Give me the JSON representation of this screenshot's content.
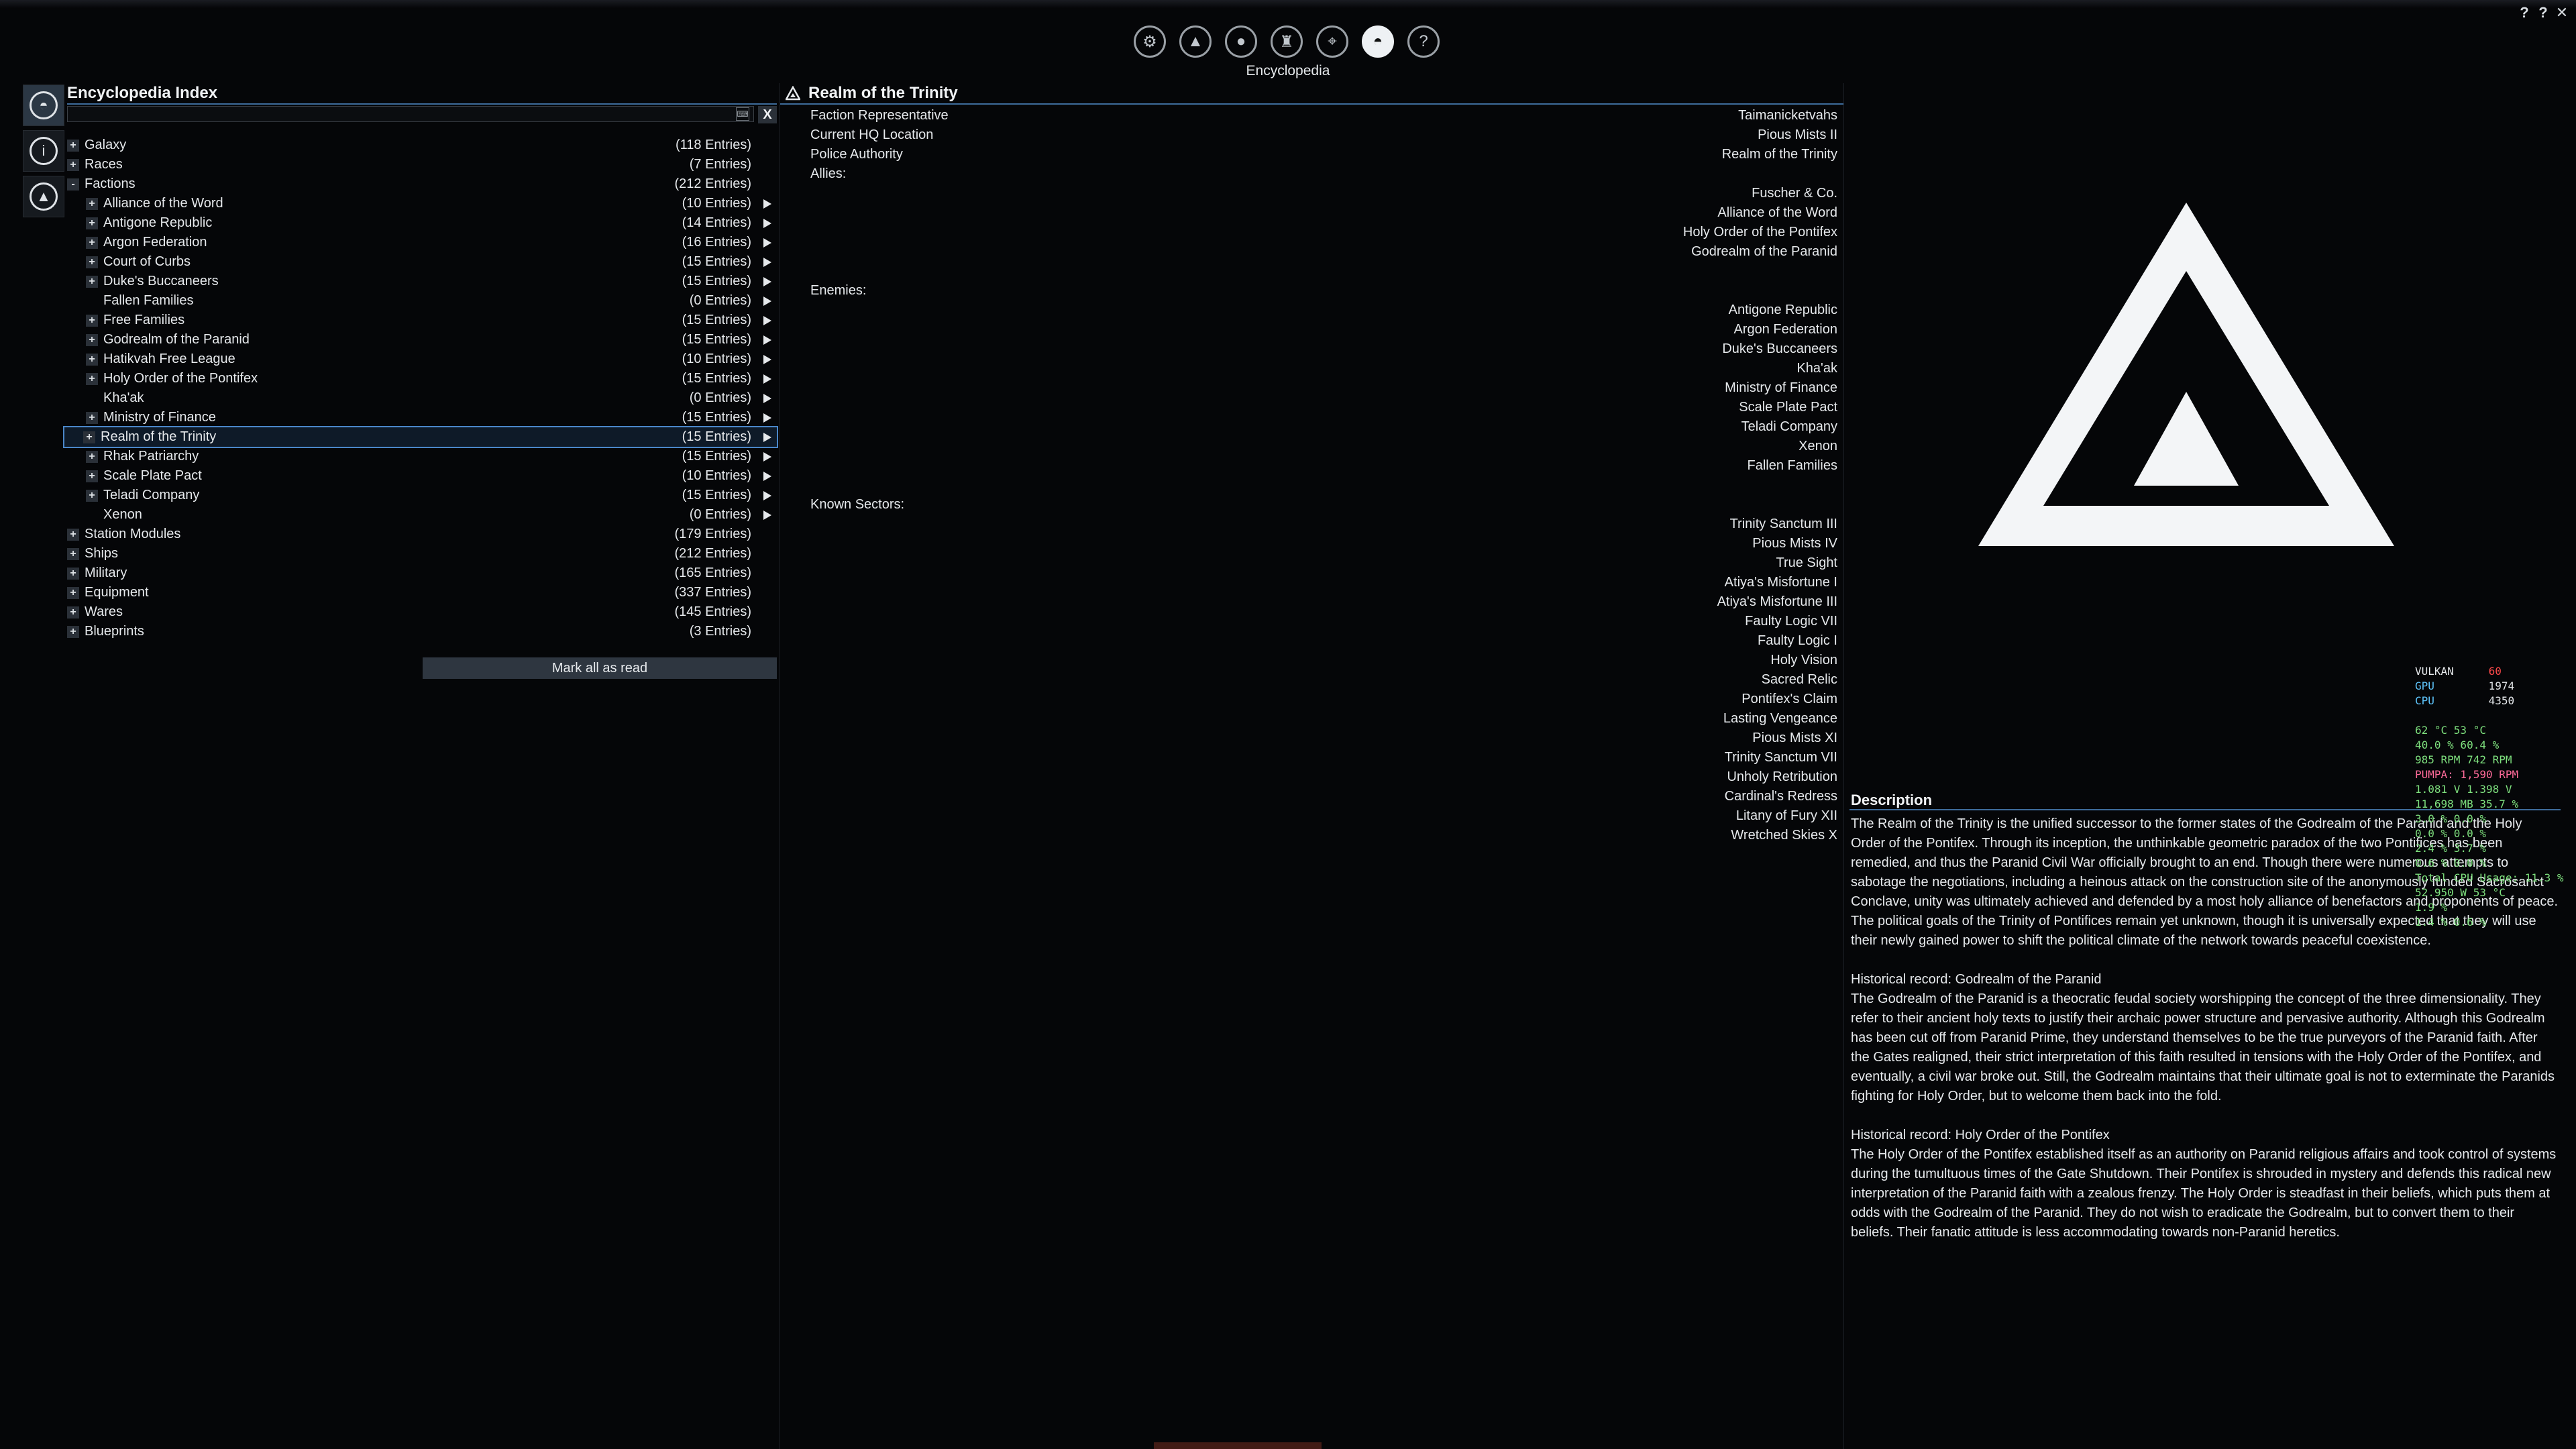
{
  "window": {
    "controls": [
      "?",
      "?",
      "✕"
    ]
  },
  "topbar": {
    "label": "Encyclopedia",
    "icons": [
      {
        "name": "settings-icon",
        "glyph": "⚙"
      },
      {
        "name": "faction-icon",
        "glyph": "▲"
      },
      {
        "name": "player-icon",
        "glyph": "●"
      },
      {
        "name": "ship-icon",
        "glyph": "♜"
      },
      {
        "name": "map-icon",
        "glyph": "⌖"
      },
      {
        "name": "encyclopedia-icon",
        "glyph": "◓",
        "active": true
      },
      {
        "name": "help-icon",
        "glyph": "?"
      }
    ]
  },
  "rail": [
    {
      "name": "encyclopedia-tab-icon",
      "glyph": "◓",
      "active": true
    },
    {
      "name": "info-tab-icon",
      "glyph": "i"
    },
    {
      "name": "faction-tab-icon",
      "glyph": "▲"
    }
  ],
  "index": {
    "title": "Encyclopedia Index",
    "search_value": "",
    "clear_label": "X",
    "mark_all_label": "Mark all as read",
    "rows": [
      {
        "level": 0,
        "expander": "+",
        "label": "Galaxy",
        "count": "(118 Entries)",
        "arrow": false
      },
      {
        "level": 0,
        "expander": "+",
        "label": "Races",
        "count": "(7 Entries)",
        "arrow": false
      },
      {
        "level": 0,
        "expander": "-",
        "label": "Factions",
        "count": "(212 Entries)",
        "arrow": false
      },
      {
        "level": 1,
        "expander": "+",
        "label": "Alliance of the Word",
        "count": "(10 Entries)",
        "arrow": true
      },
      {
        "level": 1,
        "expander": "+",
        "label": "Antigone Republic",
        "count": "(14 Entries)",
        "arrow": true
      },
      {
        "level": 1,
        "expander": "+",
        "label": "Argon Federation",
        "count": "(16 Entries)",
        "arrow": true
      },
      {
        "level": 1,
        "expander": "+",
        "label": "Court of Curbs",
        "count": "(15 Entries)",
        "arrow": true
      },
      {
        "level": 1,
        "expander": "+",
        "label": "Duke's Buccaneers",
        "count": "(15 Entries)",
        "arrow": true
      },
      {
        "level": 1,
        "expander": "",
        "label": "Fallen Families",
        "count": "(0 Entries)",
        "arrow": true
      },
      {
        "level": 1,
        "expander": "+",
        "label": "Free Families",
        "count": "(15 Entries)",
        "arrow": true
      },
      {
        "level": 1,
        "expander": "+",
        "label": "Godrealm of the Paranid",
        "count": "(15 Entries)",
        "arrow": true
      },
      {
        "level": 1,
        "expander": "+",
        "label": "Hatikvah Free League",
        "count": "(10 Entries)",
        "arrow": true
      },
      {
        "level": 1,
        "expander": "+",
        "label": "Holy Order of the Pontifex",
        "count": "(15 Entries)",
        "arrow": true
      },
      {
        "level": 1,
        "expander": "",
        "label": "Kha'ak",
        "count": "(0 Entries)",
        "arrow": true
      },
      {
        "level": 1,
        "expander": "+",
        "label": "Ministry of Finance",
        "count": "(15 Entries)",
        "arrow": true
      },
      {
        "level": 1,
        "expander": "+",
        "label": "Realm of the Trinity",
        "count": "(15 Entries)",
        "arrow": true,
        "selected": true
      },
      {
        "level": 1,
        "expander": "+",
        "label": "Rhak Patriarchy",
        "count": "(15 Entries)",
        "arrow": true
      },
      {
        "level": 1,
        "expander": "+",
        "label": "Scale Plate Pact",
        "count": "(10 Entries)",
        "arrow": true
      },
      {
        "level": 1,
        "expander": "+",
        "label": "Teladi Company",
        "count": "(15 Entries)",
        "arrow": true
      },
      {
        "level": 1,
        "expander": "",
        "label": "Xenon",
        "count": "(0 Entries)",
        "arrow": true
      },
      {
        "level": 0,
        "expander": "+",
        "label": "Station Modules",
        "count": "(179 Entries)",
        "arrow": false
      },
      {
        "level": 0,
        "expander": "+",
        "label": "Ships",
        "count": "(212 Entries)",
        "arrow": false
      },
      {
        "level": 0,
        "expander": "+",
        "label": "Military",
        "count": "(165 Entries)",
        "arrow": false
      },
      {
        "level": 0,
        "expander": "+",
        "label": "Equipment",
        "count": "(337 Entries)",
        "arrow": false
      },
      {
        "level": 0,
        "expander": "+",
        "label": "Wares",
        "count": "(145 Entries)",
        "arrow": false
      },
      {
        "level": 0,
        "expander": "+",
        "label": "Blueprints",
        "count": "(3 Entries)",
        "arrow": false
      }
    ]
  },
  "detail": {
    "title": "Realm of the Trinity",
    "labels": {
      "representative": "Faction Representative",
      "hq": "Current HQ Location",
      "police": "Police Authority",
      "allies": "Allies:",
      "enemies": "Enemies:",
      "sectors": "Known Sectors:"
    },
    "representative": "Taimanicketvahs",
    "hq": "Pious Mists II",
    "police": "Realm of the Trinity",
    "allies": [
      "Fuscher & Co.",
      "Alliance of the Word",
      "Holy Order of the Pontifex",
      "Godrealm of the Paranid"
    ],
    "enemies": [
      "Antigone Republic",
      "Argon Federation",
      "Duke's Buccaneers",
      "Kha'ak",
      "Ministry of Finance",
      "Scale Plate Pact",
      "Teladi Company",
      "Xenon",
      "Fallen Families"
    ],
    "sectors": [
      "Trinity Sanctum III",
      "Pious Mists IV",
      "True Sight",
      "Atiya's Misfortune I",
      "Atiya's Misfortune III",
      "Faulty Logic VII",
      "Faulty Logic I",
      "Holy Vision",
      "Sacred Relic",
      "Pontifex's Claim",
      "Lasting Vengeance",
      "Pious Mists XI",
      "Trinity Sanctum VII",
      "Unholy Retribution",
      "Cardinal's Redress",
      "Litany of Fury XII",
      "Wretched Skies X"
    ]
  },
  "description": {
    "title": "Description",
    "intro": "The Realm of the Trinity is the unified successor to the former states of the Godrealm of the Paranid and the Holy Order of the Pontifex. Through its inception, the unthinkable geometric paradox of the two Pontifices has been remedied, and thus the Paranid Civil War officially brought to an end. Though there were numerous attempts to sabotage the negotiations, including a heinous attack on the construction site of the anonymously funded Sacrosanct Conclave, unity was ultimately achieved and defended by a most holy alliance of benefactors and proponents of peace. The political goals of the Trinity of Pontifices remain yet unknown, though it is universally expected that they will use their newly gained power to shift the political climate of the network towards peaceful coexistence.",
    "hist1_title": "Historical record: Godrealm of the Paranid",
    "hist1": "The Godrealm of the Paranid is a theocratic feudal society worshipping the concept of the three dimensionality. They refer to their ancient holy texts to justify their archaic power structure and pervasive authority. Although this Godrealm has been cut off from Paranid Prime, they understand themselves to be the true purveyors of the Paranid faith. After the Gates realigned, their strict interpretation of this faith resulted in tensions with the Holy Order of the Pontifex, and eventually, a civil war broke out. Still, the Godrealm maintains that their ultimate goal is not to exterminate the Paranids fighting for Holy Order, but to welcome them back into the fold.",
    "hist2_title": "Historical record: Holy Order of the Pontifex",
    "hist2": "The Holy Order of the Pontifex established itself as an authority on Paranid religious affairs and took control of systems during the tumultuous times of the Gate Shutdown. Their Pontifex is shrouded in mystery and defends this radical new interpretation of the Paranid faith with a zealous frenzy. The Holy Order is steadfast in their beliefs, which puts them at odds with the Godrealm of the Paranid. They do not wish to eradicate the Godrealm, but to convert them to their beliefs. Their fanatic attitude is less accommodating towards non-Paranid heretics."
  },
  "hud": {
    "api": "VULKAN",
    "fps": "60",
    "gpu_label": "GPU",
    "gpu_mhz": "1974",
    "cpu_label": "CPU",
    "cpu_mhz": "4350",
    "lines": [
      {
        "cls": "g",
        "text": "62 °C 53 °C"
      },
      {
        "cls": "g",
        "text": "40.0 % 60.4 %"
      },
      {
        "cls": "g",
        "text": "985 RPM 742 RPM"
      },
      {
        "cls": "p",
        "text": "PUMPA: 1,590 RPM"
      },
      {
        "cls": "g",
        "text": "1.081 V 1.398 V"
      },
      {
        "cls": "g",
        "text": "11,698 MB 35.7 %"
      },
      {
        "cls": "g",
        "text": "3.0 % 0.0 %"
      },
      {
        "cls": "g",
        "text": "0.0 % 0.0 %"
      },
      {
        "cls": "g",
        "text": "2.4 % 3.7 %"
      },
      {
        "cls": "g",
        "text": "0.6 % 0.0 %"
      },
      {
        "cls": "g",
        "text": "Total CPU Usage: 11.3 %"
      },
      {
        "cls": "g",
        "text": "52.950 W 53 °C"
      },
      {
        "cls": "g",
        "text": "1.9 %"
      },
      {
        "cls": "g",
        "text": "1.4 % 0.6 %"
      }
    ]
  }
}
